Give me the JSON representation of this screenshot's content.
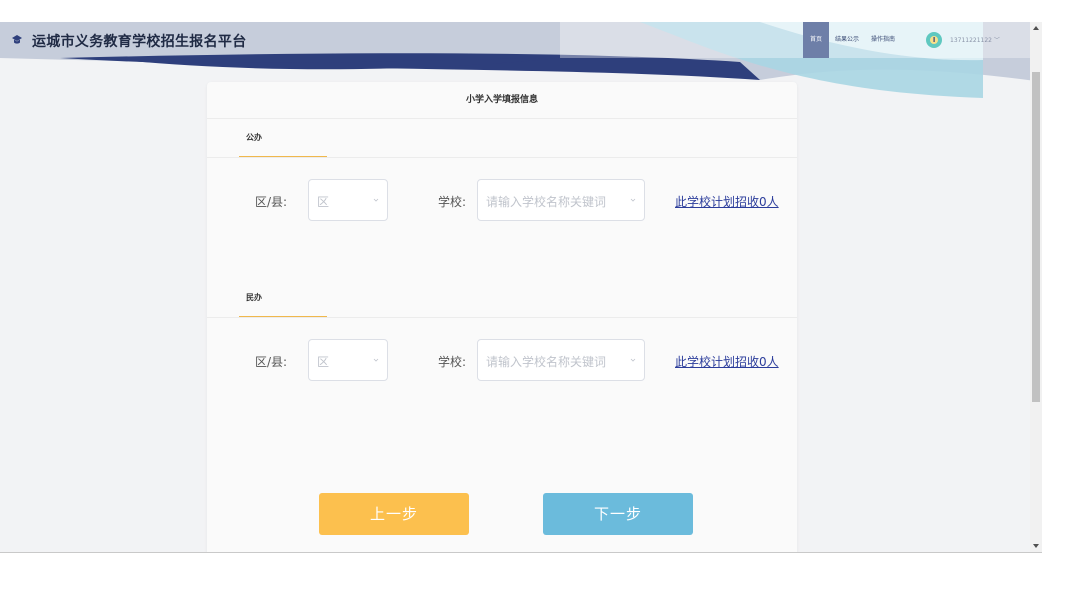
{
  "header": {
    "title": "运城市义务教育学校招生报名平台",
    "nav": [
      {
        "label": "首页",
        "active": true
      },
      {
        "label": "结果公示",
        "active": false
      },
      {
        "label": "操作指南",
        "active": false
      }
    ],
    "user": "13711221122"
  },
  "form": {
    "title": "小学入学填报信息",
    "sections": [
      {
        "tab": "公办",
        "district_label": "区/县:",
        "district_placeholder": "区",
        "school_label": "学校:",
        "school_placeholder": "请输入学校名称关键词",
        "plan_link": "此学校计划招收0人"
      },
      {
        "tab": "民办",
        "district_label": "区/县:",
        "district_placeholder": "区",
        "school_label": "学校:",
        "school_placeholder": "请输入学校名称关键词",
        "plan_link": "此学校计划招收0人"
      }
    ],
    "prev_label": "上一步",
    "next_label": "下一步"
  },
  "colors": {
    "accent_orange": "#fcc04e",
    "accent_blue": "#6bbbdc",
    "header_navy": "#2e3f7c",
    "link_blue": "#2b3c9b"
  }
}
